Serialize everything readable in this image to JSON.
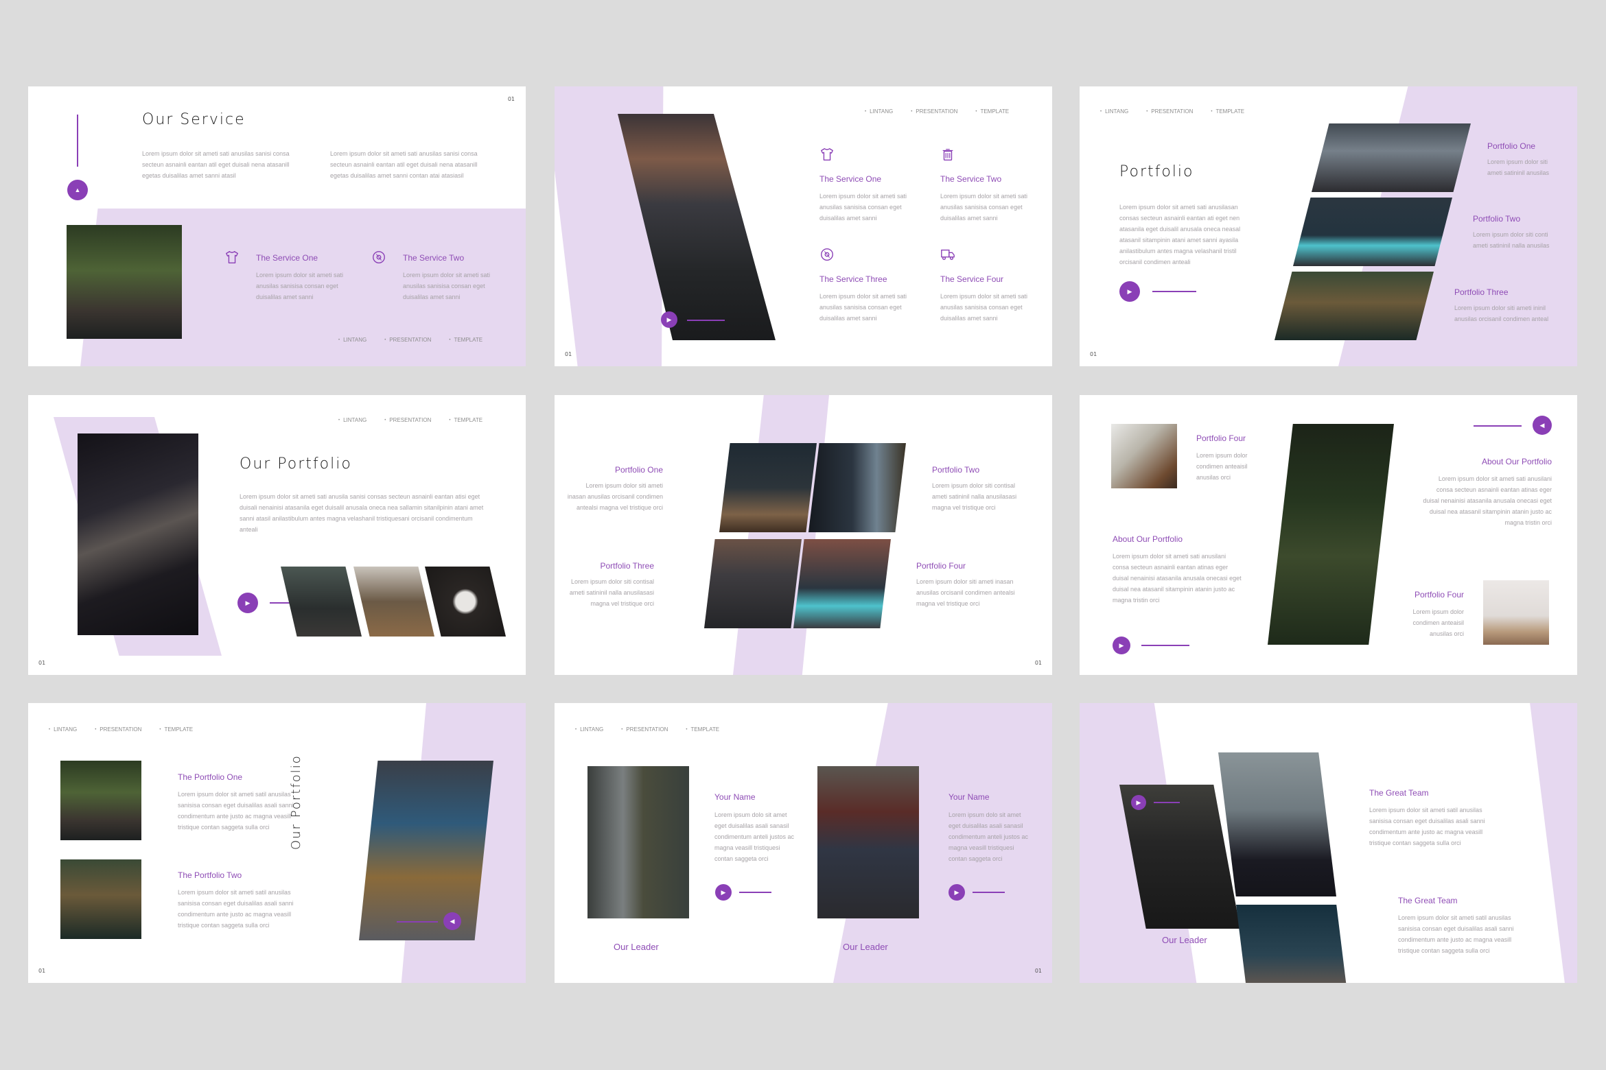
{
  "theme": {
    "accent": "#8a3fb6",
    "lavender": "#e6d8f0",
    "background": "#dcdcdc"
  },
  "nav": [
    "LINTANG",
    "PRESENTATION",
    "TEMPLATE"
  ],
  "slide_number": "01",
  "slides": [
    {
      "title": "Our Service",
      "intro": [
        "Lorem ipsum dolor sit ameti sati anusilas sanisi consa secteun asnainli eantan atil eget duisali nena atasanill egetas duisalilas amet sanni atasil",
        "Lorem ipsum dolor sit ameti sati anusilas sanisi consa secteun asnainli eantan atil eget duisali nena atasanill egetas duisalilas amet sanni contan atai atasiasil"
      ],
      "services": [
        {
          "icon": "tshirt-icon",
          "name": "The Service One",
          "text": "Lorem ipsum dolor sit ameti sati anusilas sanisisa consan eget duisalilas amet sanni"
        },
        {
          "icon": "disc-icon",
          "name": "The Service Two",
          "text": "Lorem ipsum dolor sit ameti sati anusilas sanisisa consan eget duisalilas amet sanni"
        }
      ]
    },
    {
      "services": [
        {
          "icon": "tshirt-icon",
          "name": "The Service One",
          "text": "Lorem ipsum dolor sit ameti sati anusilas sanisisa consan eget duisalilas amet sanni"
        },
        {
          "icon": "trash-icon",
          "name": "The Service Two",
          "text": "Lorem ipsum dolor sit ameti sati anusilas sanisisa consan eget duisalilas amet sanni"
        },
        {
          "icon": "disc-icon",
          "name": "The Service Three",
          "text": "Lorem ipsum dolor sit ameti sati anusilas sanisisa consan eget duisalilas amet sanni"
        },
        {
          "icon": "truck-icon",
          "name": "The Service Four",
          "text": "Lorem ipsum dolor sit ameti sati anusilas sanisisa consan eget duisalilas amet sanni"
        }
      ]
    },
    {
      "title": "Portfolio",
      "text": "Lorem ipsum dolor sit ameti sati anusilasan consas secteun asnainli eantan ati eget nen atasanila eget duisalil anusala oneca neasal atasanil sitampinin atani amet sanni ayasila anilastibulum antes magna velashanil tristil orcisanil condimen anteali",
      "items": [
        {
          "name": "Portfolio One",
          "text": "Lorem ipsum dolor siti ameti satininil anusilas"
        },
        {
          "name": "Portfolio Two",
          "text": "Lorem ipsum dolor siti conti ameti satininil nalla anusilas"
        },
        {
          "name": "Portfolio Three",
          "text": "Lorem ipsum dolor siti ameti ininil anusilas orcisanil condimen anteal"
        }
      ]
    },
    {
      "title": "Our Portfolio",
      "text": "Lorem ipsum dolor sit ameti sati anusila sanisi consas secteun asnainli eantan atisi eget duisali nenainisi atasanila eget duisalil anusala oneca nea sallamin sitanilpinin atani amet sanni atasil anilastibulum antes magna velashanil tristiquesani orcisanil condimentum anteali"
    },
    {
      "items": [
        {
          "name": "Portfolio One",
          "text": "Lorem ipsum dolor siti ameti inasan anusilas orcisanil condimen antealsi magna vel tristique orci"
        },
        {
          "name": "Portfolio Two",
          "text": "Lorem ipsum dolor siti contisal ameti satininil nalla anusilasasi magna vel tristique orci"
        },
        {
          "name": "Portfolio Three",
          "text": "Lorem ipsum dolor siti contisal ameti satininil nalla anusilasasi magna vel tristique orci"
        },
        {
          "name": "Portfolio Four",
          "text": "Lorem ipsum dolor siti ameti inasan anusilas orcisanil condimen antealsi magna vel tristique orci"
        }
      ]
    },
    {
      "top_item": {
        "name": "Portfolio Four",
        "text": "Lorem ipsum dolor condimen anteaisil anusilas orci"
      },
      "about_right": {
        "name": "About Our Portfolio",
        "text": "Lorem ipsum dolor sit ameti sati anusilani consa secteun asnainli eantan atinas eger duisal nenainisi atasanila anusala onecasi eget duisal nea atasanil sitampinin atanin justo ac magna tristin orci"
      },
      "about_left": {
        "name": "About Our Portfolio",
        "text": "Lorem ipsum dolor sit ameti sati anusilani consa secteun asnainli eantan atinas eger duisal nenainisi atasanila anusala onecasi eget duisal nea atasanil sitampinin atanin justo ac magna tristin orci"
      },
      "bottom_item": {
        "name": "Portfolio Four",
        "text": "Lorem ipsum dolor condimen anteaisil anusilas orci"
      }
    },
    {
      "vertical_title": "Our Portfolio",
      "items": [
        {
          "name": "The Portfolio One",
          "text": "Lorem ipsum dolor sit ameti satil anusilas sanisisa consan eget duisalilas asali sanni condimentum ante justo ac magna veasill tristique contan saggeta sulla orci"
        },
        {
          "name": "The Portfolio Two",
          "text": "Lorem ipsum dolor sit ameti satil anusilas sanisisa consan eget duisalilas asali sanni condimentum ante justo ac magna veasill tristique contan saggeta sulla orci"
        }
      ]
    },
    {
      "people": [
        {
          "name": "Your Name",
          "text": "Lorem ipsum dolo sit amet eget duisalilas asali sanasil condimentum anteli justos ac magna veasill tristiquesi contan saggeta orci",
          "caption": "Our Leader"
        },
        {
          "name": "Your Name",
          "text": "Lorem ipsum dolo sit amet eget duisalilas asali sanasil condimentum anteli justos ac magna veasill tristiquesi contan saggeta orci",
          "caption": "Our Leader"
        }
      ]
    },
    {
      "caption": "Our Leader",
      "teams": [
        {
          "name": "The Great Team",
          "text": "Lorem ipsum dolor sit ameti satil anusilas sanisisa consan eget duisalilas asali sanni condimentum ante justo ac magna veasill tristique contan saggeta sulla orci"
        },
        {
          "name": "The Great Team",
          "text": "Lorem ipsum dolor sit ameti satil anusilas sanisisa consan eget duisalilas asali sanni condimentum ante justo ac magna veasill tristique contan saggeta sulla orci"
        }
      ]
    }
  ]
}
